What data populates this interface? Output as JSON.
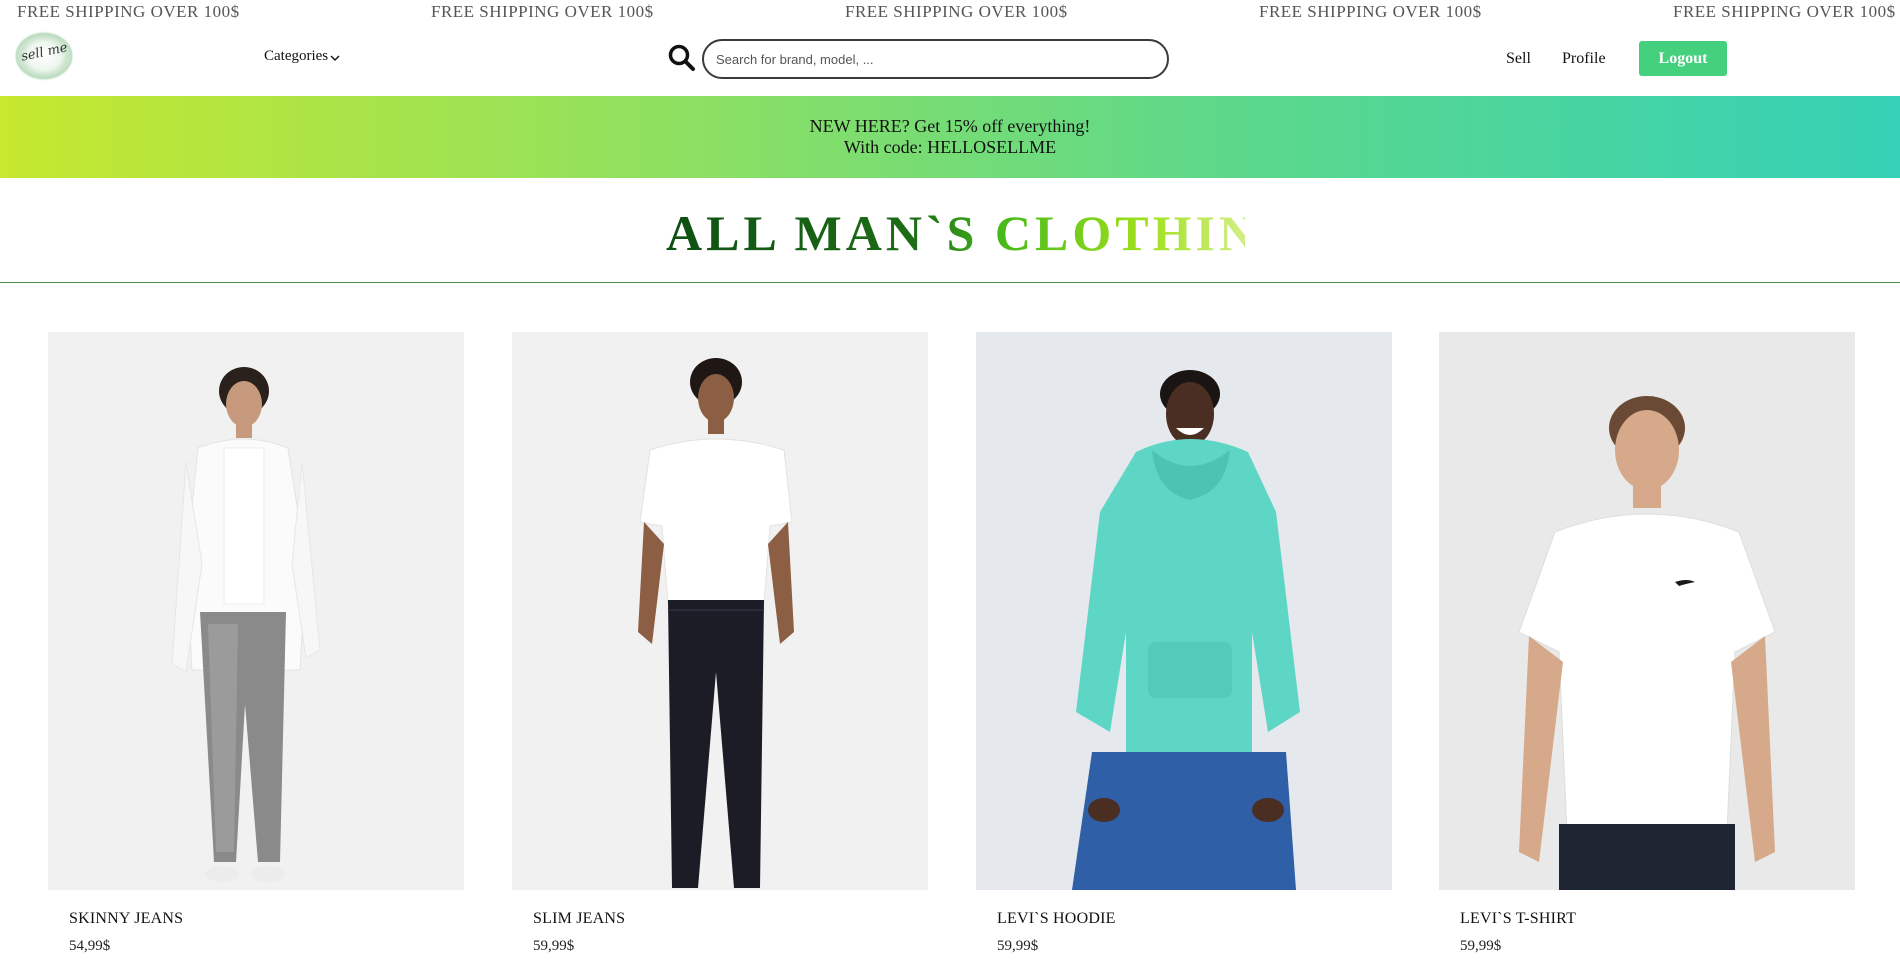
{
  "marquee": {
    "items": [
      "FREE SHIPPING OVER 100$",
      "FREE SHIPPING OVER 100$",
      "FREE SHIPPING OVER 100$",
      "FREE SHIPPING OVER 100$",
      "FREE SHIPPING OVER 100$"
    ]
  },
  "header": {
    "logo_text": "sell me",
    "categories_label": "Categories",
    "search_placeholder": "Search for brand, model, ...",
    "nav_sell": "Sell",
    "nav_profile": "Profile",
    "logout_label": "Logout",
    "accent_color": "#45d07e"
  },
  "promo": {
    "line1": "NEW HERE? Get 15% off everything!",
    "line2": "With code: HELLOSELLME"
  },
  "page": {
    "heading": "ALL MAN`S CLOTHING"
  },
  "products": [
    {
      "name": "SKINNY JEANS",
      "price": "54,99$"
    },
    {
      "name": "SLIM JEANS",
      "price": "59,99$"
    },
    {
      "name": "LEVI`S HOODIE",
      "price": "59,99$"
    },
    {
      "name": "LEVI`S T-SHIRT",
      "price": "59,99$"
    }
  ]
}
